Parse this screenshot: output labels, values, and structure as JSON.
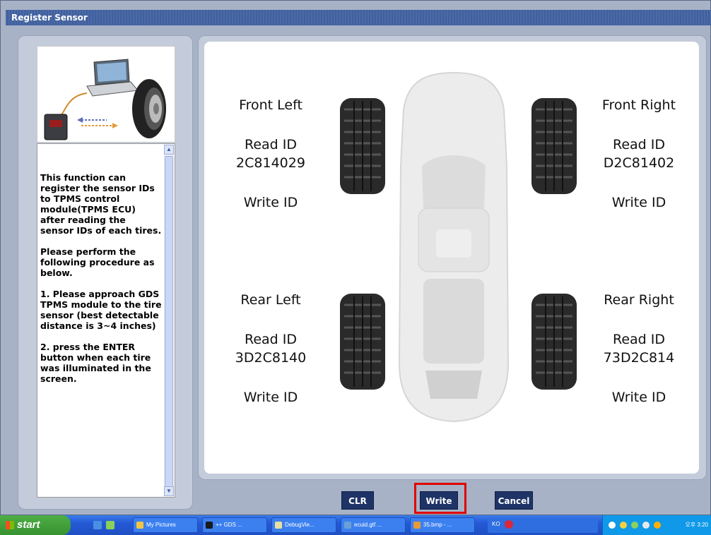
{
  "window": {
    "title": "Register Sensor"
  },
  "description": "This function can register the sensor IDs to TPMS control module(TPMS ECU) after reading the sensor IDs of each tires.\n\nPlease perform the following procedure as below.\n\n1. Please approach GDS TPMS module to the tire sensor (best detectable distance is 3~4 inches)\n\n2. press the ENTER button when each tire was illuminated in the screen.",
  "tires": {
    "front_left": {
      "name": "Front Left",
      "read_label": "Read ID",
      "read_value": "2C814029",
      "write_label": "Write ID"
    },
    "front_right": {
      "name": "Front Right",
      "read_label": "Read ID",
      "read_value": "D2C81402",
      "write_label": "Write ID"
    },
    "rear_left": {
      "name": "Rear Left",
      "read_label": "Read ID",
      "read_value": "3D2C8140",
      "write_label": "Write ID"
    },
    "rear_right": {
      "name": "Rear Right",
      "read_label": "Read ID",
      "read_value": "73D2C814",
      "write_label": "Write ID"
    }
  },
  "buttons": {
    "clr": "CLR",
    "write": "Write",
    "cancel": "Cancel"
  },
  "taskbar": {
    "start": "start",
    "items": [
      "My Pictures",
      "++ GDS ...",
      "DebugVie...",
      "ecuid.gtf ...",
      "35.bmp - ...",
      "KO"
    ],
    "clock": "오후 3:20"
  },
  "colors": {
    "title_bar": "#3f5f9e",
    "button_bg": "#1f3466",
    "highlight": "#e00000"
  }
}
